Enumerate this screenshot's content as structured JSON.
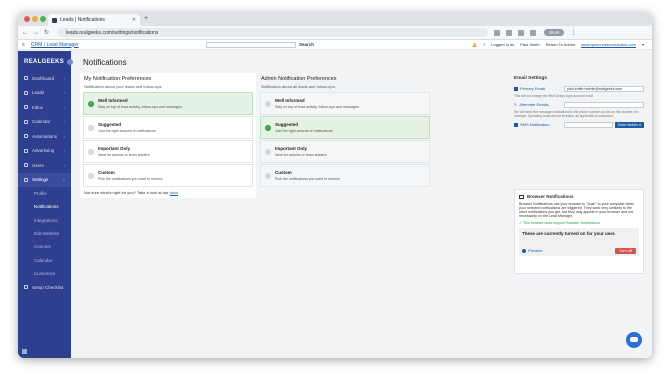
{
  "browser": {
    "tab_title": "Leads | Notifications",
    "url": "leads.realgeeks.com/settings/notifications",
    "profile_label": "Work"
  },
  "header": {
    "crm_link": "CRM / Lead Manager",
    "search_label": "Search",
    "logged_in_as": "Logged in as",
    "user_name": "Paul Smith",
    "return_to_admin": "Return To Admin",
    "website_link": "www.quinnrealtorwebsites.com"
  },
  "sidebar": {
    "brand": "REALGEEKS",
    "items": [
      {
        "label": "Dashboard"
      },
      {
        "label": "Leads"
      },
      {
        "label": "Inbox"
      },
      {
        "label": "Calendar"
      },
      {
        "label": "Automations"
      },
      {
        "label": "Advertising"
      },
      {
        "label": "Users"
      },
      {
        "label": "Settings"
      }
    ],
    "sub_items": [
      {
        "label": "Profile"
      },
      {
        "label": "Notifications"
      },
      {
        "label": "Integrations"
      },
      {
        "label": "Edit Website"
      },
      {
        "label": "Courses"
      },
      {
        "label": "Calendar"
      },
      {
        "label": "Customize"
      }
    ],
    "setup_checklist": "Setup Checklist"
  },
  "page": {
    "title": "Notifications"
  },
  "my_prefs": {
    "heading": "My Notification Preferences",
    "subheading": "Notification about your leads and follow-ups.",
    "options": [
      {
        "title": "Well Informed",
        "desc": "Stay on top of lead activity, follow-ups and messages"
      },
      {
        "title": "Suggested",
        "desc": "Just the right amount of notifications"
      },
      {
        "title": "Important Only",
        "desc": "Ideal for admins or team leaders"
      },
      {
        "title": "Custom",
        "desc": "Pick the notifications you want to receive"
      }
    ],
    "hint_text": "Not sure what's right for you? Take a look at our",
    "hint_link": "docs"
  },
  "admin_prefs": {
    "heading": "Admin Notification Preferences",
    "subheading": "Notification about all leads and follow-ups.",
    "options": [
      {
        "title": "Well Informed",
        "desc": "Stay on top of lead activity, follow-ups and messages"
      },
      {
        "title": "Suggested",
        "desc": "Just the right amount of notifications"
      },
      {
        "title": "Important Only",
        "desc": "Ideal for admins or team leaders"
      },
      {
        "title": "Custom",
        "desc": "Pick the notifications you want to receive"
      }
    ]
  },
  "email_settings": {
    "heading": "Email Settings",
    "primary_label": "Primary Email",
    "primary_value": "paul.smith+admin@realgeeks.com",
    "primary_note": "This will not change the Real Geeks login account email",
    "alternate_label": "Alternate Emails",
    "sms_note": "We will send text message notifications to the phone number you list on this number, for example. Operating costs are not included, as applicable to customers",
    "sms_label": "SMS Notification",
    "verify_button": "Enter Mobile #"
  },
  "browser_notifications": {
    "heading": "Browser Notifications",
    "body": "Browser Notifications use your browser to \"push\" to your computer when your selected notifications are triggered. They work very similarly to the other notifications you get, but they only appear in your browser and not necessarily on the Lead Manager.",
    "supported": "This browser does support Browser Notifications",
    "status_text": "These are currently turned on for your user.",
    "preview_label": "Preview",
    "turn_off_label": "Turn off"
  }
}
